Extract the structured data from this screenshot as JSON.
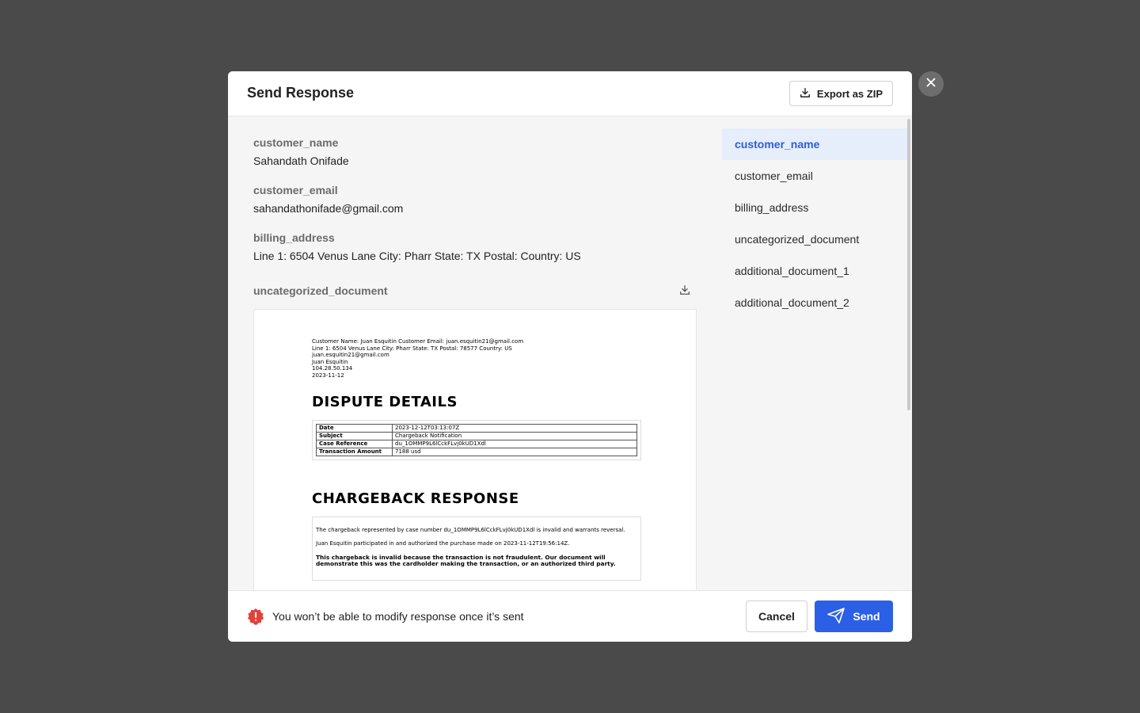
{
  "modal": {
    "title": "Send Response",
    "export_label": "Export as ZIP"
  },
  "fields": [
    {
      "label": "customer_name",
      "value": "Sahandath Onifade"
    },
    {
      "label": "customer_email",
      "value": "sahandathonifade@gmail.com"
    },
    {
      "label": "billing_address",
      "value": "Line 1: 6504 Venus Lane City: Pharr State: TX Postal: Country: US"
    }
  ],
  "document": {
    "label": "uncategorized_document",
    "preview": {
      "meta_lines": [
        "Customer Name: Juan Esquitin Customer Email: juan.esquitin21@gmail.com",
        "Line 1: 6504 Venus Lane City: Pharr State: TX Postal: 78577 Country: US",
        "juan.esquitin21@gmail.com",
        "Juan Esquitin",
        "104.28.50.134",
        "2023-11-12"
      ],
      "dispute_heading": "DISPUTE DETAILS",
      "dispute_rows": [
        {
          "k": "Date",
          "v": "2023-12-12T03:13:07Z"
        },
        {
          "k": "Subject",
          "v": "Chargeback Notification"
        },
        {
          "k": "Case Reference",
          "v": "du_1OMMP9L6lCckFLvj0kUD1Xdl"
        },
        {
          "k": "Transaction Amount",
          "v": "7188 usd"
        }
      ],
      "response_heading": "CHARGEBACK RESPONSE",
      "response_p1": "The chargeback represented by case number du_1OMMP9L6lCckFLvj0kUD1Xdl is invalid and warrants reversal.",
      "response_p2": "Juan Esquitin participated in and authorized the purchase made on 2023-11-12T19:56:14Z.",
      "response_p3": "This chargeback is invalid because the transaction is not fraudulent. Our document will demonstrate this was the cardholder making the transaction, or an authorized third party."
    }
  },
  "nav": {
    "items": [
      "customer_name",
      "customer_email",
      "billing_address",
      "uncategorized_document",
      "additional_document_1",
      "additional_document_2"
    ],
    "active_index": 0
  },
  "footer": {
    "warning": "You won’t be able to modify response once it’s sent",
    "cancel_label": "Cancel",
    "send_label": "Send"
  },
  "colors": {
    "backdrop": "#4a4a4a",
    "accent": "#2b5fe6",
    "active_nav_bg": "#e6edfb",
    "warning_red": "#e0413a"
  },
  "icons": {
    "export": "download-icon",
    "close": "close-icon",
    "doc_download": "download-icon",
    "warning": "alert-badge-icon",
    "send": "paper-plane-icon"
  }
}
